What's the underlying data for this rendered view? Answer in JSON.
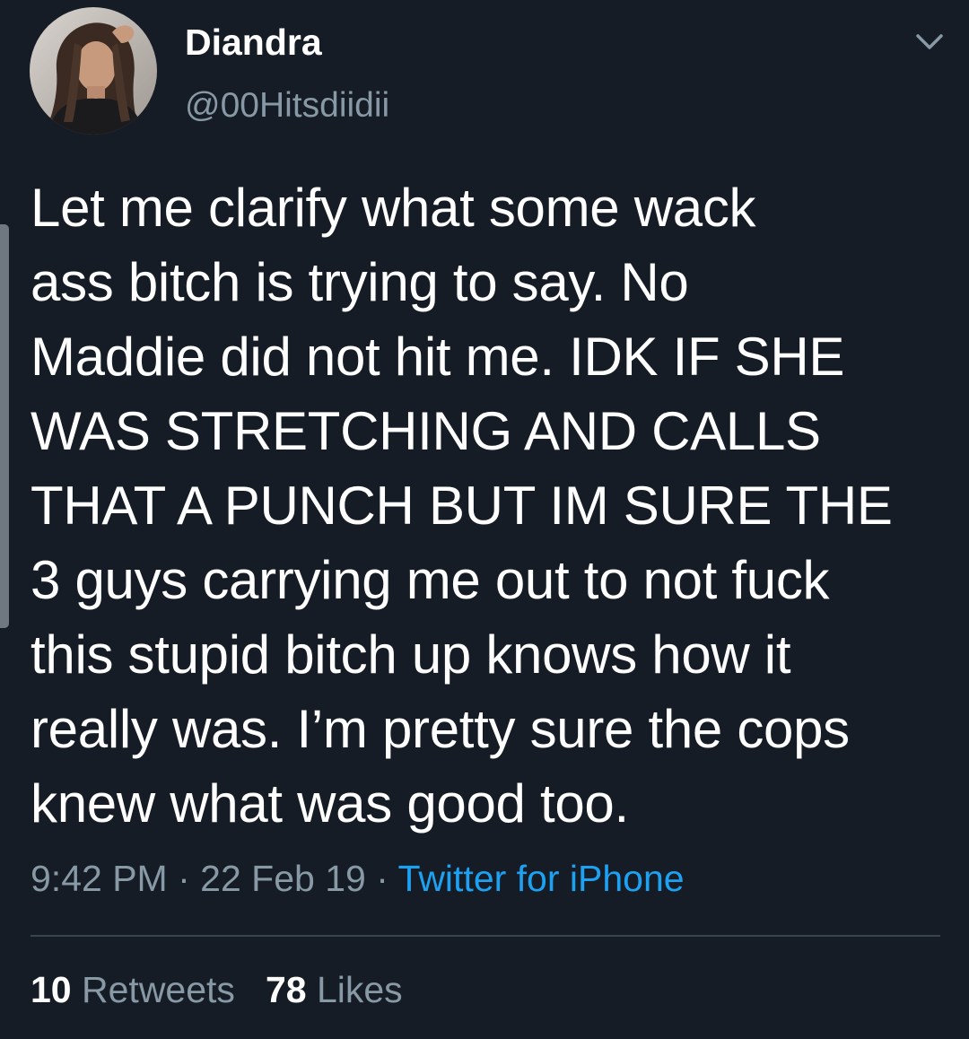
{
  "tweet": {
    "display_name": "Diandra",
    "handle": "@00Hitsdiidii",
    "text": "Let me clarify what some wack\nass bitch is trying to say. No\nMaddie did not hit me. IDK IF SHE\nWAS STRETCHING AND CALLS\nTHAT A PUNCH BUT IM SURE THE\n3 guys carrying me out to not fuck\nthis stupid bitch up knows how it\nreally was. I’m pretty sure the cops\nknew what was good too.",
    "time": "9:42 PM",
    "separator": "·",
    "date": "22 Feb 19",
    "source": "Twitter for iPhone",
    "retweets_count": "10",
    "retweets_label": "Retweets",
    "likes_count": "78",
    "likes_label": "Likes"
  },
  "icons": {
    "more": "chevron-down-icon",
    "avatar": "profile-photo"
  },
  "colors": {
    "background": "#151c25",
    "primary_text": "#ffffff",
    "secondary_text": "#8899a6",
    "link": "#1da1f2",
    "divider": "#38444d"
  }
}
